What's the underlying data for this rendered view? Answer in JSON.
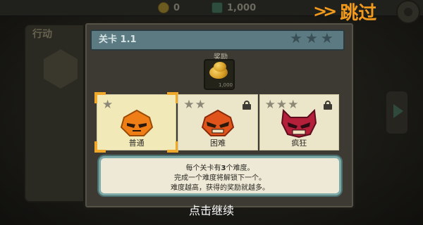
{
  "topbar": {
    "coins": "0",
    "gems": "1,000"
  },
  "side": {
    "title": "行动"
  },
  "skip": {
    "label": "跳过"
  },
  "dialog": {
    "title": "关卡 1.1",
    "reward_label": "奖励",
    "reward_amount": "1,000",
    "difficulties": [
      {
        "label": "普通",
        "stars": 1,
        "locked": false,
        "selected": true,
        "color": "#f07e16",
        "icon": "orange-mask-icon"
      },
      {
        "label": "困难",
        "stars": 2,
        "locked": true,
        "selected": false,
        "color": "#e0541b",
        "icon": "red-mask-icon"
      },
      {
        "label": "疯狂",
        "stars": 3,
        "locked": true,
        "selected": false,
        "color": "#b41f3a",
        "icon": "crimson-devil-mask-icon"
      }
    ],
    "info": {
      "line1_pre": "每个关卡有",
      "line1_num": "3",
      "line1_post": "个难度。",
      "line2": "完成一个难度将解锁下一个。",
      "line3": "难度越高，获得的奖励就越多。"
    }
  },
  "continue_label": "点击继续",
  "colors": {
    "accent_orange": "#f19a1d",
    "header_teal": "#5c7a82",
    "card_bg": "#ebe5c9"
  }
}
